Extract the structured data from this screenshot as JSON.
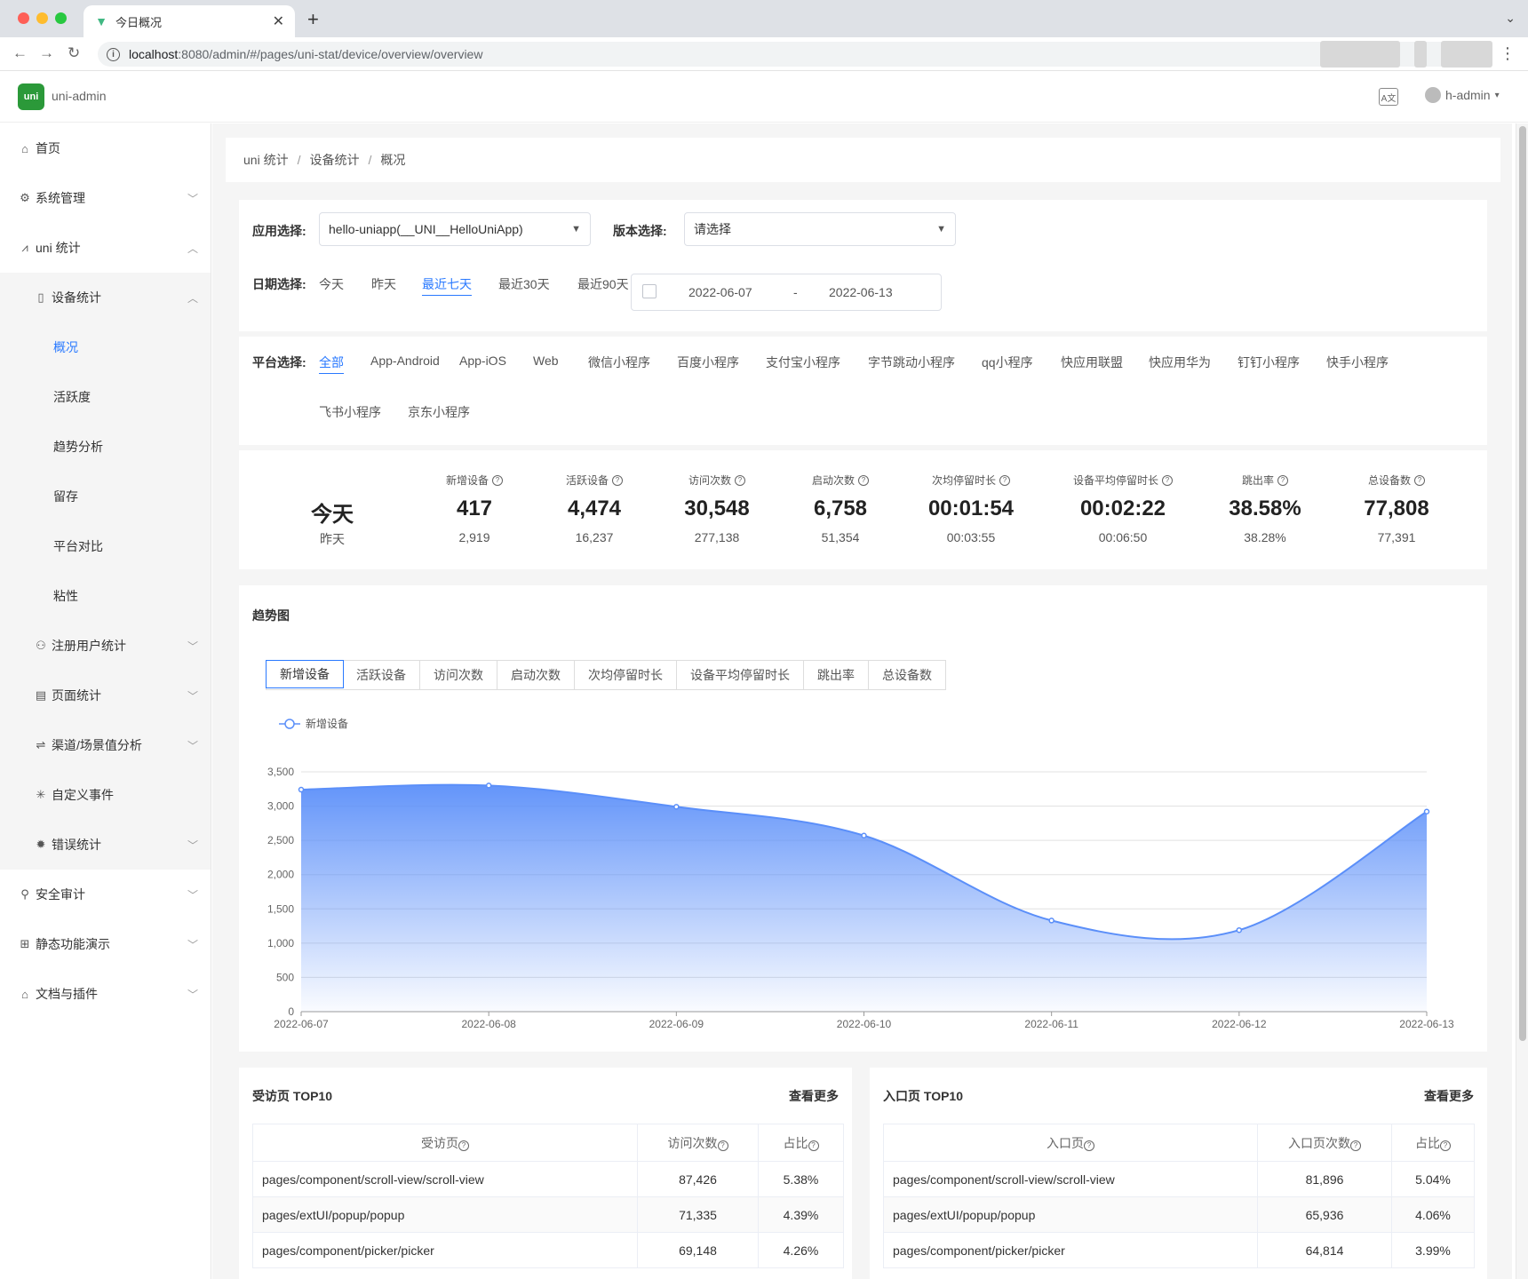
{
  "browser": {
    "tab_title": "今日概况",
    "url_host": "localhost",
    "url_rest": ":8080/admin/#/pages/uni-stat/device/overview/overview"
  },
  "app": {
    "name": "uni-admin",
    "logo_text": "uni",
    "user": "h-admin"
  },
  "sidebar": {
    "home": "首页",
    "system": "系统管理",
    "uni_stat": "uni 统计",
    "device_stat": "设备统计",
    "device_items": [
      "概况",
      "活跃度",
      "趋势分析",
      "留存",
      "平台对比",
      "粘性"
    ],
    "reg_user": "注册用户统计",
    "page_stat": "页面统计",
    "channel": "渠道/场景值分析",
    "custom_event": "自定义事件",
    "error_stat": "错误统计",
    "security": "安全审计",
    "static_demo": "静态功能演示",
    "docs": "文档与插件"
  },
  "breadcrumb": [
    "uni 统计",
    "设备统计",
    "概况"
  ],
  "filters": {
    "app_label": "应用选择:",
    "app_value": "hello-uniapp(__UNI__HelloUniApp)",
    "version_label": "版本选择:",
    "version_placeholder": "请选择",
    "date_label": "日期选择:",
    "date_options": [
      "今天",
      "昨天",
      "最近七天",
      "最近30天",
      "最近90天"
    ],
    "date_start": "2022-06-07",
    "date_sep": "-",
    "date_end": "2022-06-13"
  },
  "platforms": {
    "label": "平台选择:",
    "row1": [
      "全部",
      "App-Android",
      "App-iOS",
      "Web",
      "微信小程序",
      "百度小程序",
      "支付宝小程序",
      "字节跳动小程序",
      "qq小程序",
      "快应用联盟",
      "快应用华为",
      "钉钉小程序",
      "快手小程序"
    ],
    "row2": [
      "飞书小程序",
      "京东小程序"
    ]
  },
  "kpi": {
    "today": "今天",
    "yesterday": "昨天",
    "items": [
      {
        "label": "新增设备",
        "value": "417",
        "prev": "2,919"
      },
      {
        "label": "活跃设备",
        "value": "4,474",
        "prev": "16,237"
      },
      {
        "label": "访问次数",
        "value": "30,548",
        "prev": "277,138"
      },
      {
        "label": "启动次数",
        "value": "6,758",
        "prev": "51,354"
      },
      {
        "label": "次均停留时长",
        "value": "00:01:54",
        "prev": "00:03:55"
      },
      {
        "label": "设备平均停留时长",
        "value": "00:02:22",
        "prev": "00:06:50"
      },
      {
        "label": "跳出率",
        "value": "38.58%",
        "prev": "38.28%"
      },
      {
        "label": "总设备数",
        "value": "77,808",
        "prev": "77,391"
      }
    ]
  },
  "trend": {
    "title": "趋势图",
    "tabs": [
      "新增设备",
      "活跃设备",
      "访问次数",
      "启动次数",
      "次均停留时长",
      "设备平均停留时长",
      "跳出率",
      "总设备数"
    ]
  },
  "chart_data": {
    "type": "area",
    "x": [
      "2022-06-07",
      "2022-06-08",
      "2022-06-09",
      "2022-06-10",
      "2022-06-11",
      "2022-06-12",
      "2022-06-13"
    ],
    "series": [
      {
        "name": "新增设备",
        "values": [
          3240,
          3300,
          2990,
          2570,
          1330,
          1190,
          2920
        ]
      }
    ],
    "ylim": [
      0,
      3500
    ],
    "yticks": [
      0,
      500,
      1000,
      1500,
      2000,
      2500,
      3000,
      3500
    ],
    "ytick_labels": [
      "0",
      "500",
      "1,000",
      "1,500",
      "2,000",
      "2,500",
      "3,000",
      "3,500"
    ],
    "legend": "top-left",
    "grid": true,
    "color": "#5b8ff9"
  },
  "top_pages": {
    "title": "受访页 TOP10",
    "more": "查看更多",
    "headers": [
      "受访页",
      "访问次数",
      "占比"
    ],
    "rows": [
      [
        "pages/component/scroll-view/scroll-view",
        "87,426",
        "5.38%"
      ],
      [
        "pages/extUI/popup/popup",
        "71,335",
        "4.39%"
      ],
      [
        "pages/component/picker/picker",
        "69,148",
        "4.26%"
      ]
    ]
  },
  "entry_pages": {
    "title": "入口页 TOP10",
    "more": "查看更多",
    "headers": [
      "入口页",
      "入口页次数",
      "占比"
    ],
    "rows": [
      [
        "pages/component/scroll-view/scroll-view",
        "81,896",
        "5.04%"
      ],
      [
        "pages/extUI/popup/popup",
        "65,936",
        "4.06%"
      ],
      [
        "pages/component/picker/picker",
        "64,814",
        "3.99%"
      ]
    ]
  }
}
